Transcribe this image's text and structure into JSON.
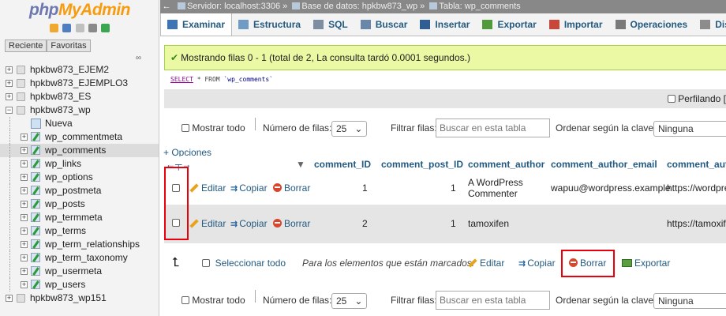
{
  "nav": {
    "logo_a": "php",
    "logo_b": "MyAdmin",
    "icon_colors": [
      "#f0a830",
      "#4f7fc0",
      "#c0c0c0",
      "#8a8a8a",
      "#3aa64f"
    ],
    "tab_recent": "Reciente",
    "tab_favorites": "Favoritas",
    "link_icon": "∞",
    "tree": [
      {
        "label": "hpkbw873_EJEM2",
        "kind": "db",
        "level": 0
      },
      {
        "label": "hpkbw873_EJEMPLO3",
        "kind": "db",
        "level": 0
      },
      {
        "label": "hpkbw873_ES",
        "kind": "db",
        "level": 0
      },
      {
        "label": "hpkbw873_wp",
        "kind": "db",
        "level": 0,
        "expanded": true
      },
      {
        "label": "Nueva",
        "kind": "new",
        "level": 1
      },
      {
        "label": "wp_commentmeta",
        "kind": "table",
        "level": 1
      },
      {
        "label": "wp_comments",
        "kind": "table",
        "level": 1,
        "selected": true
      },
      {
        "label": "wp_links",
        "kind": "table",
        "level": 1
      },
      {
        "label": "wp_options",
        "kind": "table",
        "level": 1
      },
      {
        "label": "wp_postmeta",
        "kind": "table",
        "level": 1
      },
      {
        "label": "wp_posts",
        "kind": "table",
        "level": 1
      },
      {
        "label": "wp_termmeta",
        "kind": "table",
        "level": 1
      },
      {
        "label": "wp_terms",
        "kind": "table",
        "level": 1
      },
      {
        "label": "wp_term_relationships",
        "kind": "table",
        "level": 1
      },
      {
        "label": "wp_term_taxonomy",
        "kind": "table",
        "level": 1
      },
      {
        "label": "wp_usermeta",
        "kind": "table",
        "level": 1
      },
      {
        "label": "wp_users",
        "kind": "table",
        "level": 1
      },
      {
        "label": "hpkbw873_wp151",
        "kind": "db",
        "level": 0
      }
    ]
  },
  "breadcrumb": {
    "server": "Servidor: localhost:3306",
    "sep1": "»",
    "database": "Base de datos: hpkbw873_wp",
    "sep2": "»",
    "table": "Tabla: wp_comments"
  },
  "tabs": [
    {
      "label": "Examinar",
      "icon": "browse-icon",
      "color": "#3d74b5"
    },
    {
      "label": "Estructura",
      "icon": "structure-icon",
      "color": "#6f9bc4"
    },
    {
      "label": "SQL",
      "icon": "sql-icon",
      "color": "#7d8ea3"
    },
    {
      "label": "Buscar",
      "icon": "search-icon",
      "color": "#6a86a8"
    },
    {
      "label": "Insertar",
      "icon": "insert-icon",
      "color": "#2f5e94"
    },
    {
      "label": "Exportar",
      "icon": "export-icon",
      "color": "#4f9a3a"
    },
    {
      "label": "Importar",
      "icon": "import-icon",
      "color": "#c8463a"
    },
    {
      "label": "Operaciones",
      "icon": "wrench-icon",
      "color": "#7a7a7a"
    },
    {
      "label": "Disparadores",
      "icon": "triggers-icon",
      "color": "#8c8c8c"
    }
  ],
  "messages": {
    "success": "Mostrando filas 0 - 1 (total de 2, La consulta tardó 0.0001 segundos.)",
    "sql_keyword": "SELECT",
    "sql_rest": " * FROM ",
    "sql_table": "`wp_comments`",
    "profiling": "Perfilando ["
  },
  "nav_controls": {
    "show_all": "Mostrar todo",
    "rows_label": "Número de filas:",
    "rows_value": "25",
    "filter_label": "Filtrar filas:",
    "filter_placeholder": "Buscar en esta tabla",
    "sort_label": "Ordenar según la clave:",
    "sort_value": "Ninguna"
  },
  "results": {
    "options_link": "+ Opciones",
    "sort_arrow": "▼",
    "columns": [
      "comment_ID",
      "comment_post_ID",
      "comment_author",
      "comment_author_email",
      "comment_auth"
    ],
    "actions": {
      "edit": "Editar",
      "copy": "Copiar",
      "delete": "Borrar"
    },
    "rows": [
      {
        "id": "1",
        "post_id": "1",
        "author_line1": "A WordPress",
        "author_line2": "Commenter",
        "email": "wapuu@wordpress.example",
        "url": "https://wordpress"
      },
      {
        "id": "2",
        "post_id": "1",
        "author_line1": "tamoxifen",
        "author_line2": "",
        "email": "",
        "url": "https://tamoxifen"
      }
    ]
  },
  "bulk": {
    "select_all": "Seleccionar todo",
    "for_marked": "Para los elementos que están marcados:",
    "edit": "Editar",
    "copy": "Copiar",
    "delete": "Borrar",
    "export": "Exportar"
  }
}
